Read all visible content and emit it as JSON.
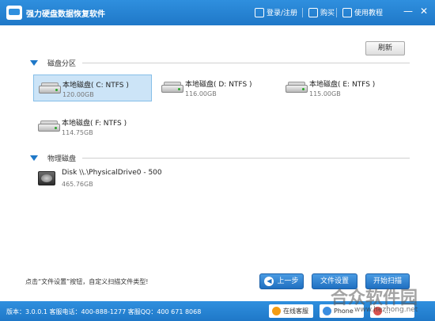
{
  "app": {
    "title": "强力硬盘数据恢复软件"
  },
  "header": {
    "login_label": "登录/注册",
    "buy_label": "购买",
    "tutorial_label": "使用教程",
    "minimize_label": "—",
    "close_label": "✕"
  },
  "toolbar": {
    "refresh_label": "刷新"
  },
  "partitions": {
    "title": "磁盘分区",
    "items": [
      {
        "name": "本地磁盘( C: NTFS )",
        "size": "120.00GB",
        "selected": true
      },
      {
        "name": "本地磁盘( D: NTFS )",
        "size": "116.00GB",
        "selected": false
      },
      {
        "name": "本地磁盘( E: NTFS )",
        "size": "115.00GB",
        "selected": false
      },
      {
        "name": "本地磁盘( F: NTFS )",
        "size": "114.75GB",
        "selected": false
      }
    ]
  },
  "physical": {
    "title": "物理磁盘",
    "items": [
      {
        "name": "Disk \\\\.\\PhysicalDrive0 - 500",
        "size": "465.76GB"
      }
    ]
  },
  "footer": {
    "hint": "点击“文件设置”按钮，自定义扫描文件类型!",
    "prev_label": "上一步",
    "file_settings_label": "文件设置",
    "start_scan_label": "开始扫描"
  },
  "statusbar": {
    "info": "版本：3.0.0.1  客服电话：400-888-1277    客服QQ：400 671 8068",
    "online_service_label": "在线客服",
    "phone_service_label": "Phone",
    "third_label": "..."
  },
  "watermark": {
    "text": "合众软件园",
    "url": "www.hezhong.net"
  },
  "colors": {
    "accent": "#1f78c8",
    "selection": "#cce4f7"
  }
}
